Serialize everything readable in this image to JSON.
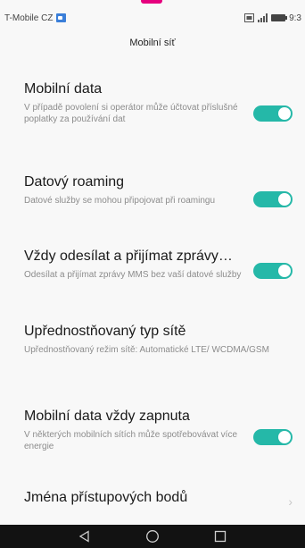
{
  "status_bar": {
    "carrier": "T-Mobile CZ",
    "time": "9:3"
  },
  "screen_title": "Mobilní síť",
  "settings": [
    {
      "title": "Mobilní data",
      "subtitle": "V případě povolení si operátor může účtovat příslušné poplatky za používání dat",
      "toggle_on": true
    },
    {
      "title": "Datový roaming",
      "subtitle": "Datové služby se mohou připojovat při roamingu",
      "toggle_on": true
    },
    {
      "title": "Vždy odesílat a přijímat zprávy…",
      "subtitle": "Odesílat a přijímat zprávy MMS bez vaší datové služby",
      "toggle_on": true
    },
    {
      "title": "Upřednostňovaný typ sítě",
      "subtitle": "Upřednostňovaný režim sítě: Automatické LTE/ WCDMA/GSM"
    },
    {
      "title": "Mobilní data vždy zapnuta",
      "subtitle": "V některých mobilních sítích může spotřebovávat více energie",
      "toggle_on": true
    },
    {
      "title": "Jména přístupových bodů"
    }
  ],
  "colors": {
    "accent": "#25b8a8",
    "top_indicator": "#e6007e",
    "nav_bar": "#121212"
  },
  "icons": {
    "nav_back": "back-triangle-icon",
    "nav_home": "home-circle-icon",
    "nav_recents": "recents-square-icon"
  }
}
